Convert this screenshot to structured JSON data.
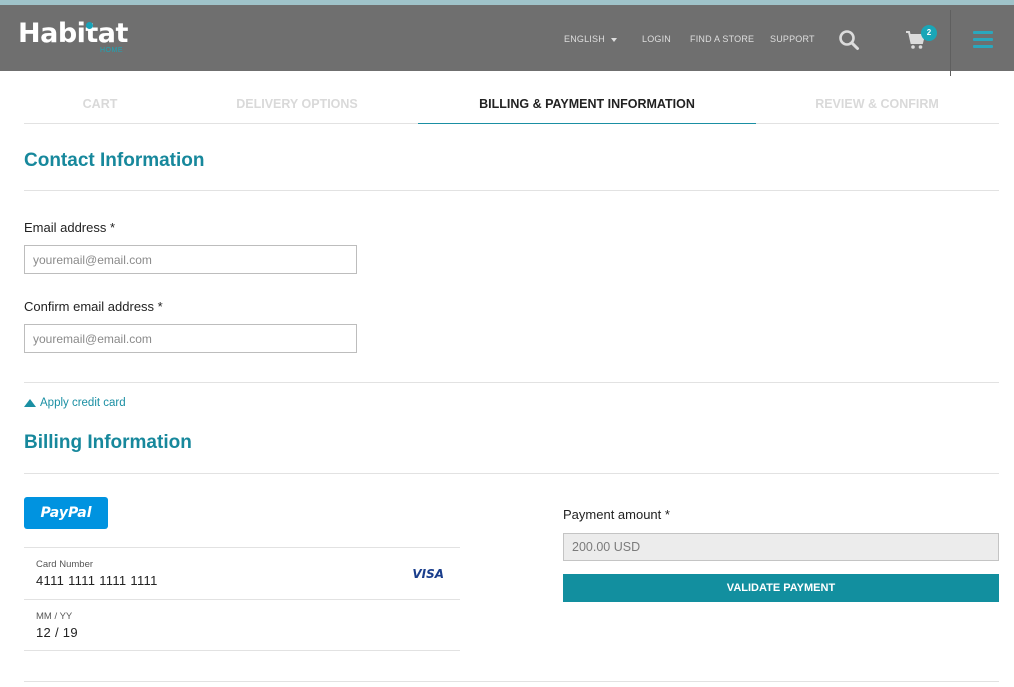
{
  "header": {
    "logo_text": "Habitat",
    "logo_sub": "HOME",
    "language": "ENGLISH",
    "nav": [
      "LOGIN",
      "FIND A STORE",
      "SUPPORT"
    ],
    "cart_count": "2",
    "colors": {
      "bar": "#6f6f6f",
      "accent": "#1aa6b7"
    },
    "icons": [
      "search-icon",
      "cart-icon",
      "hamburger-menu-icon"
    ]
  },
  "steps": [
    {
      "label": "CART",
      "active": false
    },
    {
      "label": "DELIVERY OPTIONS",
      "active": false
    },
    {
      "label": "BILLING & PAYMENT INFORMATION",
      "active": true
    },
    {
      "label": "REVIEW & CONFIRM",
      "active": false
    }
  ],
  "contact": {
    "title": "Contact Information",
    "email_label": "Email address *",
    "email_placeholder": "youremail@email.com",
    "confirm_label": "Confirm email address *",
    "confirm_placeholder": "youremail@email.com"
  },
  "apply_credit_card": "Apply credit card",
  "billing": {
    "title": "Billing Information",
    "paypal_label": "PayPal",
    "card_number_label": "Card Number",
    "card_number": "4111 1111 1111 1111",
    "card_brand": "VISA",
    "expiry_label": "MM / YY",
    "expiry": "12 / 19",
    "payment_amount_label": "Payment amount *",
    "payment_amount": "200.00 USD",
    "validate_label": "VALIDATE PAYMENT"
  },
  "colors": {
    "teal": "#17889c",
    "button": "#128f9f",
    "paypal": "#0093e0"
  }
}
